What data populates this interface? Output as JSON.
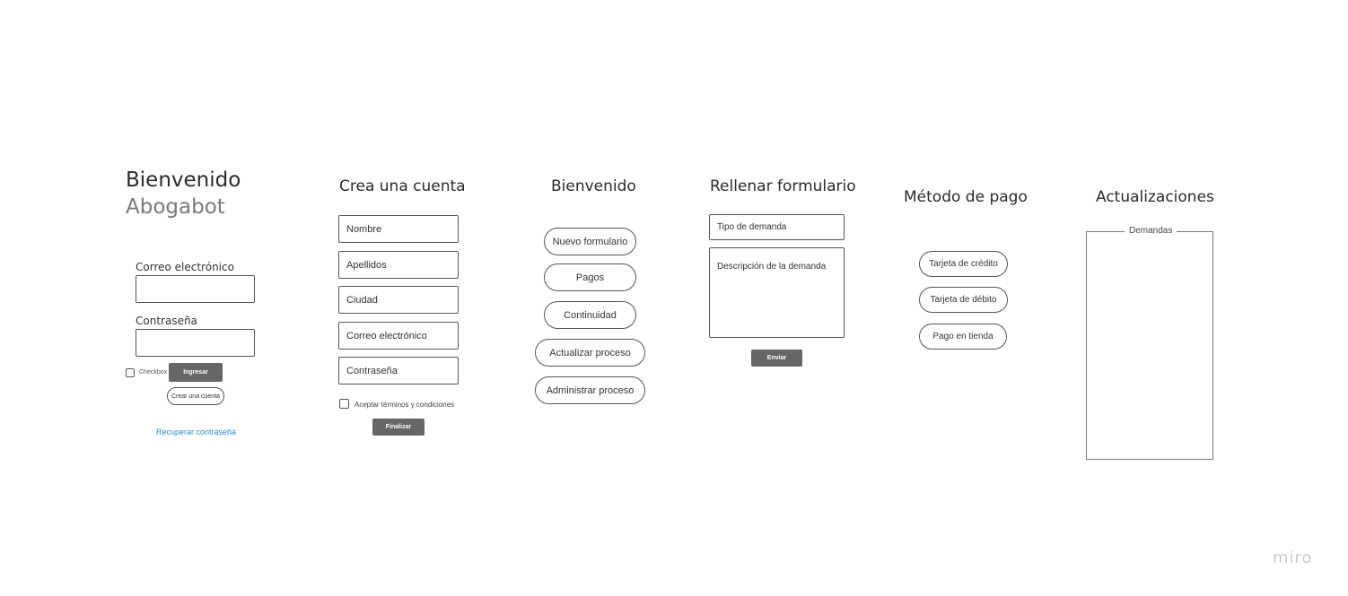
{
  "login": {
    "title": "Bienvenido",
    "subtitle": "Abogabot",
    "email_label": "Correo electrónico",
    "password_label": "Contraseña",
    "checkbox_label": "Checkbox",
    "login_button": "Ingresar",
    "create_account_button": "Crear una cuenta",
    "recover_link": "Recuperar contraseña"
  },
  "register": {
    "title": "Crea una cuenta",
    "fields": [
      "Nombre",
      "Apellidos",
      "Ciudad",
      "Correo electrónico",
      "Contraseña"
    ],
    "terms_label": "Aceptar términos y condiciones",
    "finish_button": "Finalizar"
  },
  "home": {
    "title": "Bienvenido",
    "buttons": [
      "Nuevo formulario",
      "Pagos",
      "Continuidad",
      "Actualizar proceso",
      "Administrar proceso"
    ]
  },
  "form": {
    "title": "Rellenar formulario",
    "type_placeholder": "Tipo de demanda",
    "description_placeholder": "Descripción de la demanda",
    "send_button": "Enviar"
  },
  "payment": {
    "title": "Método de pago",
    "options": [
      "Tarjeta de crédito",
      "Tarjeta de débito",
      "Pago en tienda"
    ]
  },
  "updates": {
    "title": "Actualizaciones",
    "panel_label": "Demandas"
  },
  "brand": {
    "logo": "miro"
  },
  "colors": {
    "link": "#2b8dc4",
    "button_dark": "#666666",
    "border": "#555555"
  }
}
